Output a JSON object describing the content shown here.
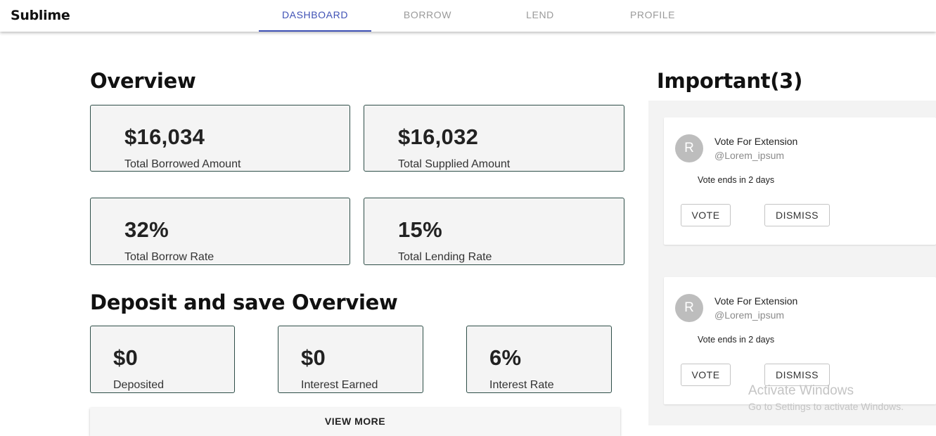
{
  "app": {
    "brand": "Sublime"
  },
  "nav": {
    "tabs": [
      {
        "label": "DASHBOARD",
        "active": true
      },
      {
        "label": "BORROW",
        "active": false
      },
      {
        "label": "LEND",
        "active": false
      },
      {
        "label": "PROFILE",
        "active": false
      }
    ]
  },
  "overview": {
    "title": "Overview",
    "cards": [
      {
        "value": "$16,034",
        "label": "Total Borrowed Amount"
      },
      {
        "value": "$16,032",
        "label": "Total Supplied Amount"
      },
      {
        "value": "32%",
        "label": "Total Borrow Rate"
      },
      {
        "value": "15%",
        "label": "Total Lending Rate"
      }
    ]
  },
  "deposit": {
    "title": "Deposit and save Overview",
    "cards": [
      {
        "value": "$0",
        "label": "Deposited"
      },
      {
        "value": "$0",
        "label": "Interest Earned"
      },
      {
        "value": "6%",
        "label": "Interest Rate"
      }
    ],
    "view_more_label": "VIEW MORE"
  },
  "important": {
    "title": "Important(3)",
    "items": [
      {
        "avatar": "R",
        "title": "Vote For Extension",
        "handle": "@Lorem_ipsum",
        "subtitle": "Vote ends in 2 days",
        "vote_label": "VOTE",
        "dismiss_label": "DISMISS"
      },
      {
        "avatar": "R",
        "title": "Vote For Extension",
        "handle": "@Lorem_ipsum",
        "subtitle": "Vote ends in 2 days",
        "vote_label": "VOTE",
        "dismiss_label": "DISMISS"
      }
    ]
  },
  "watermark": {
    "line1": "Activate Windows",
    "line2": "Go to Settings to activate Windows."
  },
  "colors": {
    "accent": "#3f51b5",
    "card_border": "#2e4e48",
    "card_bg": "#f4f4f4",
    "avatar_bg": "#bdbdbd"
  }
}
